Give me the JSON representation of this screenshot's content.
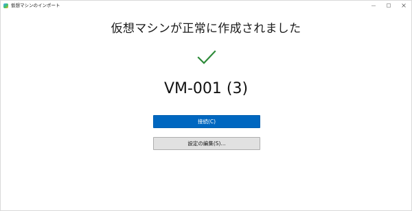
{
  "window": {
    "title": "仮想マシンのインポート"
  },
  "main": {
    "headline": "仮想マシンが正常に作成されました",
    "vm_name": "VM-001 (3)",
    "connect_button": "接続(C)",
    "edit_settings_button": "設定の編集(S)..."
  },
  "icons": {
    "app": "hyper-v-app-icon",
    "success": "checkmark-icon",
    "minimize": "minimize-icon",
    "maximize": "maximize-icon",
    "close": "close-icon"
  },
  "colors": {
    "accent": "#0067c0",
    "success": "#2e8b3a",
    "secondary_button": "#e1e1e1"
  }
}
